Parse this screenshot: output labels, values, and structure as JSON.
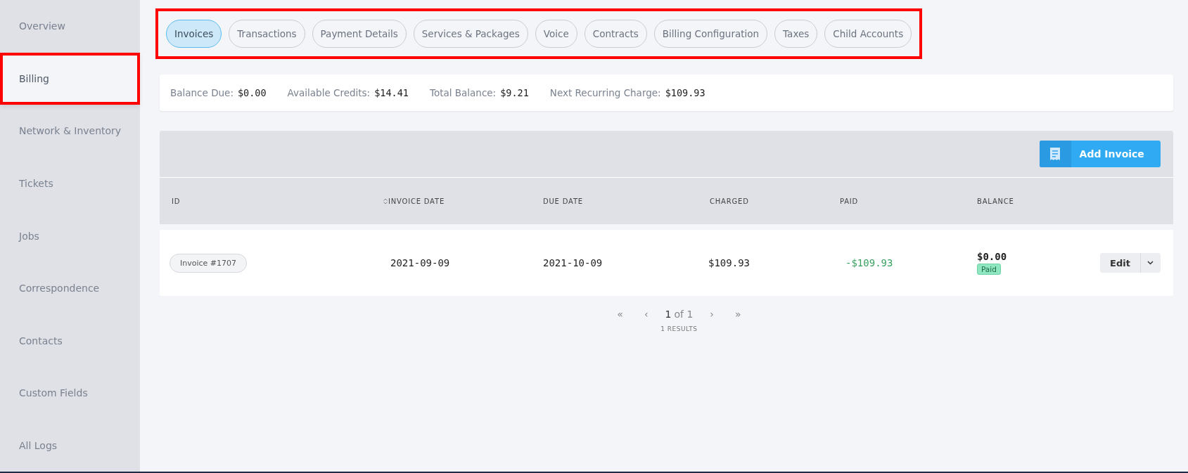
{
  "sidebar": {
    "items": [
      {
        "label": "Overview",
        "selected": false,
        "highlighted": false
      },
      {
        "label": "Billing",
        "selected": true,
        "highlighted": true
      },
      {
        "label": "Network & Inventory",
        "selected": false,
        "highlighted": false
      },
      {
        "label": "Tickets",
        "selected": false,
        "highlighted": false
      },
      {
        "label": "Jobs",
        "selected": false,
        "highlighted": false
      },
      {
        "label": "Correspondence",
        "selected": false,
        "highlighted": false
      },
      {
        "label": "Contacts",
        "selected": false,
        "highlighted": false
      },
      {
        "label": "Custom Fields",
        "selected": false,
        "highlighted": false
      },
      {
        "label": "All Logs",
        "selected": false,
        "highlighted": false
      }
    ]
  },
  "tabs_highlighted": true,
  "tabs": [
    {
      "label": "Invoices",
      "selected": true
    },
    {
      "label": "Transactions",
      "selected": false
    },
    {
      "label": "Payment Details",
      "selected": false
    },
    {
      "label": "Services & Packages",
      "selected": false
    },
    {
      "label": "Voice",
      "selected": false
    },
    {
      "label": "Contracts",
      "selected": false
    },
    {
      "label": "Billing Configuration",
      "selected": false
    },
    {
      "label": "Taxes",
      "selected": false
    },
    {
      "label": "Child Accounts",
      "selected": false
    }
  ],
  "summary": [
    {
      "label": "Balance Due:",
      "value": "$0.00"
    },
    {
      "label": "Available Credits:",
      "value": "$14.41"
    },
    {
      "label": "Total Balance:",
      "value": "$9.21"
    },
    {
      "label": "Next Recurring Charge:",
      "value": "$109.93"
    }
  ],
  "add_button": {
    "label": "Add Invoice"
  },
  "table": {
    "columns": [
      {
        "label": "ID",
        "sortable": false
      },
      {
        "label": "INVOICE DATE",
        "sortable": true
      },
      {
        "label": "DUE DATE",
        "sortable": false
      },
      {
        "label": "CHARGED",
        "sortable": false
      },
      {
        "label": "PAID",
        "sortable": false
      },
      {
        "label": "BALANCE",
        "sortable": false
      }
    ],
    "rows": [
      {
        "id": "Invoice #1707",
        "invoice_date": "2021-09-09",
        "due_date": "2021-10-09",
        "charged": "$109.93",
        "paid": "-$109.93",
        "balance": "$0.00",
        "status": "Paid",
        "action": "Edit"
      }
    ]
  },
  "pagination": {
    "first": "«",
    "prev": "‹",
    "current": "1",
    "of": "of 1",
    "next": "›",
    "last": "»",
    "results": "1 RESULTS"
  }
}
